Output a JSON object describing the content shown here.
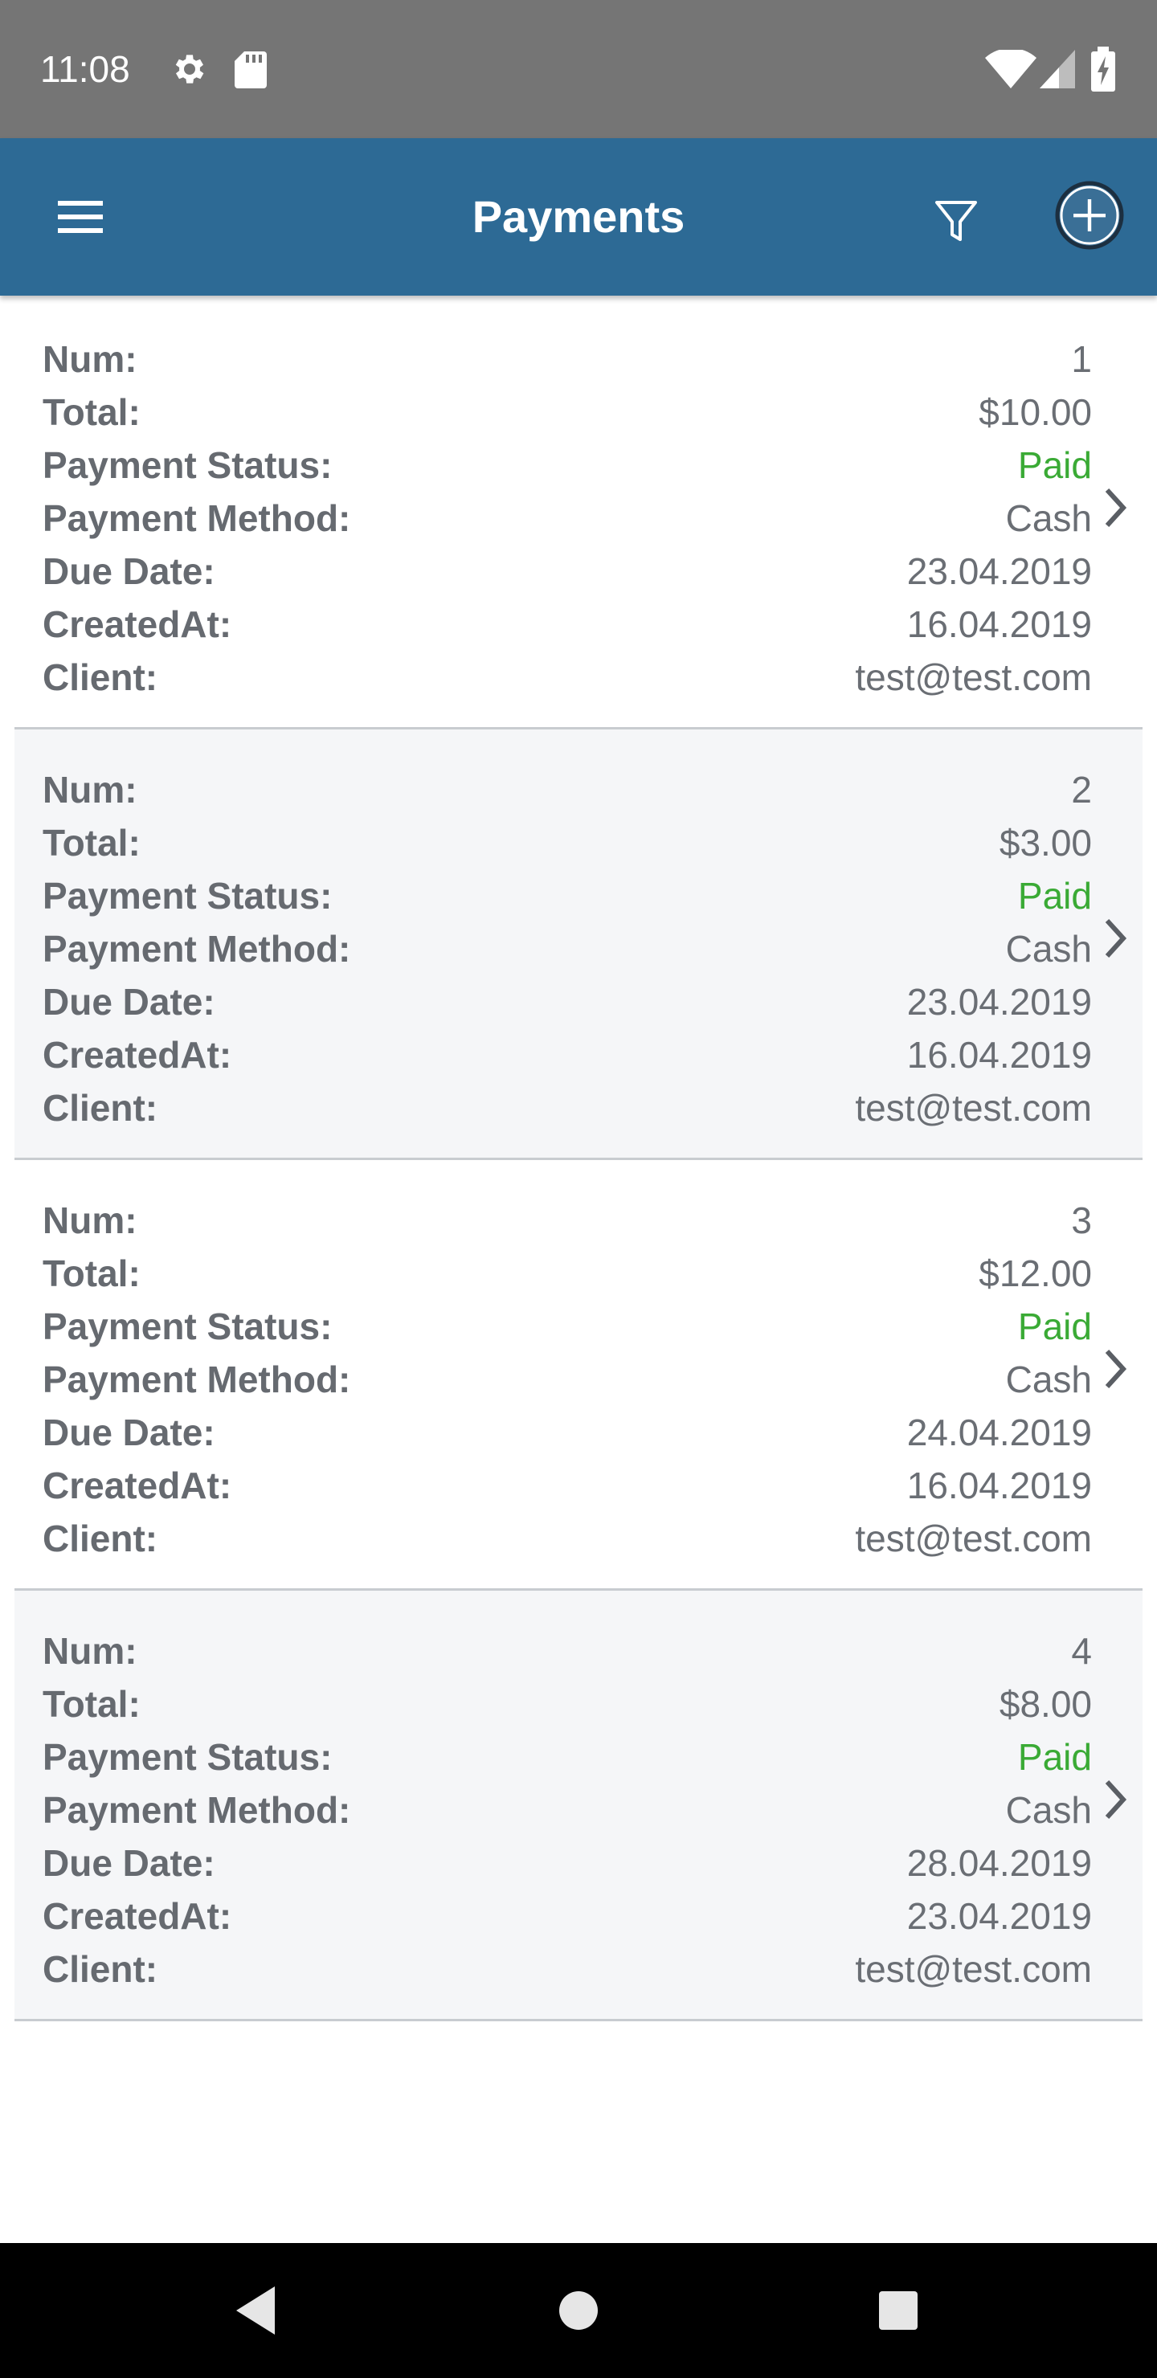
{
  "status_bar": {
    "time": "11:08",
    "icons": [
      "gear-icon",
      "sd-card-icon",
      "wifi-icon",
      "cell-signal-icon",
      "battery-charging-icon"
    ]
  },
  "app_bar": {
    "title": "Payments",
    "icons": [
      "menu-icon",
      "filter-icon",
      "add-circle-icon"
    ],
    "color": "#2d6a95"
  },
  "labels": {
    "num": "Num:",
    "total": "Total:",
    "status": "Payment Status:",
    "method": "Payment Method:",
    "due": "Due Date:",
    "created": "CreatedAt:",
    "client": "Client:"
  },
  "payments": [
    {
      "num": "1",
      "total": "$10.00",
      "status": "Paid",
      "method": "Cash",
      "due": "23.04.2019",
      "created": "16.04.2019",
      "client": "test@test.com"
    },
    {
      "num": "2",
      "total": "$3.00",
      "status": "Paid",
      "method": "Cash",
      "due": "23.04.2019",
      "created": "16.04.2019",
      "client": "test@test.com"
    },
    {
      "num": "3",
      "total": "$12.00",
      "status": "Paid",
      "method": "Cash",
      "due": "24.04.2019",
      "created": "16.04.2019",
      "client": "test@test.com"
    },
    {
      "num": "4",
      "total": "$8.00",
      "status": "Paid",
      "method": "Cash",
      "due": "28.04.2019",
      "created": "23.04.2019",
      "client": "test@test.com"
    }
  ],
  "colors": {
    "paid": "#3aaa35",
    "label": "#666a70",
    "value": "#6a6e74",
    "alt_row": "#f5f6f8"
  },
  "nav_bar": {
    "icons": [
      "back-icon",
      "home-icon",
      "recents-icon"
    ]
  }
}
